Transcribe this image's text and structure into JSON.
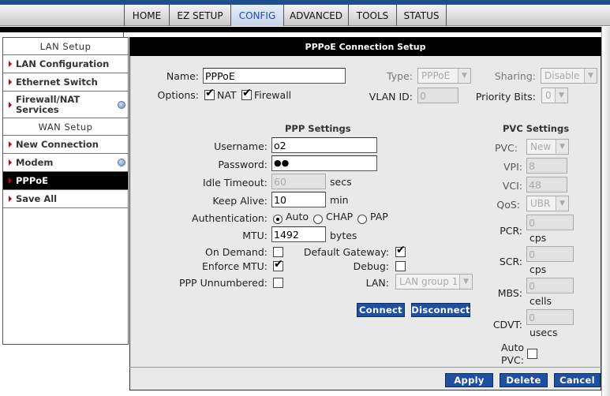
{
  "nav": {
    "tabs": [
      {
        "label": "HOME"
      },
      {
        "label": "EZ SETUP"
      },
      {
        "label": "CONFIG"
      },
      {
        "label": "ADVANCED"
      },
      {
        "label": "TOOLS"
      },
      {
        "label": "STATUS"
      }
    ],
    "active_color": "#1c4fae"
  },
  "sidebar": {
    "lan_header": "LAN Setup",
    "lan_items": [
      {
        "label": "LAN Configuration"
      },
      {
        "label": "Ethernet Switch"
      },
      {
        "label": "Firewall/NAT Services"
      }
    ],
    "wan_header": "WAN Setup",
    "wan_items": [
      {
        "label": "New Connection"
      },
      {
        "label": "Modem"
      },
      {
        "label": "PPPoE"
      },
      {
        "label": "Save All"
      }
    ]
  },
  "panel": {
    "title": "PPPoE Connection Setup",
    "name_label": "Name:",
    "name_value": "PPPoE",
    "options_label": "Options:",
    "nat_label": "NAT",
    "firewall_label": "Firewall",
    "type_label": "Type:",
    "type_value": "PPPoE",
    "sharing_label": "Sharing:",
    "sharing_value": "Disable",
    "vlan_label": "VLAN ID:",
    "vlan_value": "0",
    "priority_label": "Priority Bits:",
    "priority_value": "0"
  },
  "ppp": {
    "header": "PPP Settings",
    "username_label": "Username:",
    "username_value": "o2",
    "password_label": "Password:",
    "password_value": "●●",
    "idle_label": "Idle Timeout:",
    "idle_value": "60",
    "idle_unit": "secs",
    "keepalive_label": "Keep Alive:",
    "keepalive_value": "10",
    "keepalive_unit": "min",
    "auth_label": "Authentication:",
    "auth_auto": "Auto",
    "auth_chap": "CHAP",
    "auth_pap": "PAP",
    "mtu_label": "MTU:",
    "mtu_value": "1492",
    "mtu_unit": "bytes",
    "ondemand_label": "On Demand:",
    "defgw_label": "Default Gateway:",
    "enforce_label": "Enforce MTU:",
    "debug_label": "Debug:",
    "unnumbered_label": "PPP Unnumbered:",
    "lan_label": "LAN:",
    "lan_value": "LAN group 1",
    "connect_btn": "Connect",
    "disconnect_btn": "Disconnect"
  },
  "pvc": {
    "header": "PVC Settings",
    "pvc_label": "PVC:",
    "pvc_value": "New",
    "vpi_label": "VPI:",
    "vpi_value": "8",
    "vci_label": "VCI:",
    "vci_value": "48",
    "qos_label": "QoS:",
    "qos_value": "UBR",
    "pcr_label": "PCR:",
    "pcr_value": "0",
    "pcr_unit": "cps",
    "scr_label": "SCR:",
    "scr_value": "0",
    "scr_unit": "cps",
    "mbs_label": "MBS:",
    "mbs_value": "0",
    "mbs_unit": "cells",
    "cdvt_label": "CDVT:",
    "cdvt_value": "0",
    "cdvt_unit": "usecs",
    "autopvc_label_1": "Auto",
    "autopvc_label_2": "PVC:"
  },
  "footer": {
    "apply": "Apply",
    "delete": "Delete",
    "cancel": "Cancel"
  }
}
